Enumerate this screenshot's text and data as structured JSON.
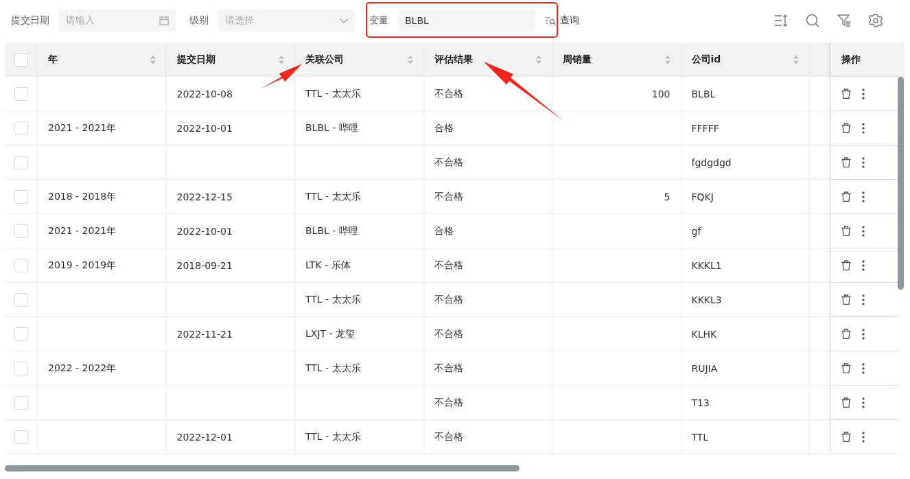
{
  "filters": [
    {
      "label": "提交日期",
      "kind": "date",
      "placeholder": "请输入"
    },
    {
      "label": "级别",
      "kind": "select",
      "placeholder": "请选择"
    },
    {
      "label": "变量",
      "kind": "text",
      "value": "BLBL",
      "highlighted": true
    }
  ],
  "query_button": {
    "label": "查询"
  },
  "table": {
    "select_all_checked": false,
    "columns": [
      {
        "kind": "text",
        "title": "年",
        "sortable": true
      },
      {
        "kind": "text",
        "title": "提交日期",
        "sortable": true
      },
      {
        "kind": "text",
        "title": "关联公司",
        "sortable": true
      },
      {
        "kind": "text",
        "title": "评估结果",
        "sortable": true
      },
      {
        "kind": "number",
        "title": "周销量",
        "sortable": true
      },
      {
        "kind": "text",
        "title": "公司id",
        "sortable": true
      }
    ],
    "action_column": {
      "title": "操作"
    },
    "rows": [
      {
        "checked": false,
        "cells": [
          null,
          "2022-10-08",
          "TTL - 太太乐",
          "不合格",
          "100",
          "BLBL"
        ]
      },
      {
        "checked": false,
        "cells": [
          "2021 - 2021年",
          "2022-10-01",
          "BLBL - 哔哩",
          "合格",
          null,
          "FFFFF"
        ]
      },
      {
        "checked": false,
        "cells": [
          null,
          null,
          null,
          "不合格",
          null,
          "fgdgdgd"
        ]
      },
      {
        "checked": false,
        "cells": [
          "2018 - 2018年",
          "2022-12-15",
          "TTL - 太太乐",
          "不合格",
          "5",
          "FQKJ"
        ]
      },
      {
        "checked": false,
        "cells": [
          "2021 - 2021年",
          "2022-10-01",
          "BLBL - 哔哩",
          "合格",
          null,
          "gf"
        ]
      },
      {
        "checked": false,
        "cells": [
          "2019 - 2019年",
          "2018-09-21",
          "LTK - 乐体",
          "不合格",
          null,
          "KKKL1"
        ]
      },
      {
        "checked": false,
        "cells": [
          null,
          null,
          "TTL - 太太乐",
          "不合格",
          null,
          "KKKL3"
        ]
      },
      {
        "checked": false,
        "cells": [
          null,
          "2022-11-21",
          "LXJT - 龙玺",
          "不合格",
          null,
          "KLHK"
        ]
      },
      {
        "checked": false,
        "cells": [
          "2022 - 2022年",
          null,
          "TTL - 太太乐",
          "不合格",
          null,
          "RUJIA"
        ]
      },
      {
        "checked": false,
        "cells": [
          null,
          null,
          null,
          "不合格",
          null,
          "T13"
        ]
      },
      {
        "checked": false,
        "cells": [
          null,
          "2022-12-01",
          "TTL - 太太乐",
          "不合格",
          null,
          "TTL"
        ]
      }
    ]
  }
}
